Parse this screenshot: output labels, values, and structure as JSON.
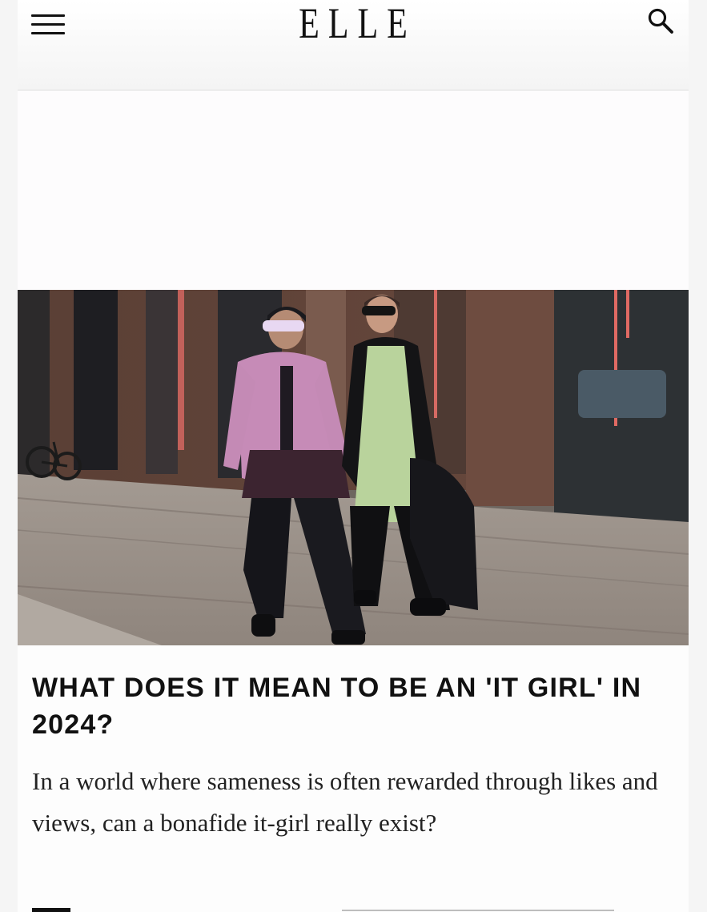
{
  "header": {
    "menu_icon": "hamburger-menu-icon",
    "logo": "ELLE",
    "search_icon": "search-icon"
  },
  "article": {
    "headline": "WHAT DOES IT MEAN TO BE AN 'IT GIRL' IN 2024?",
    "dek": "In a world where sameness is often rewarded through likes and views, can a bonafide it-girl really exist?"
  },
  "colors": {
    "text": "#111111",
    "background": "#fdfdfd",
    "header_bg": "#f4f4f4"
  }
}
